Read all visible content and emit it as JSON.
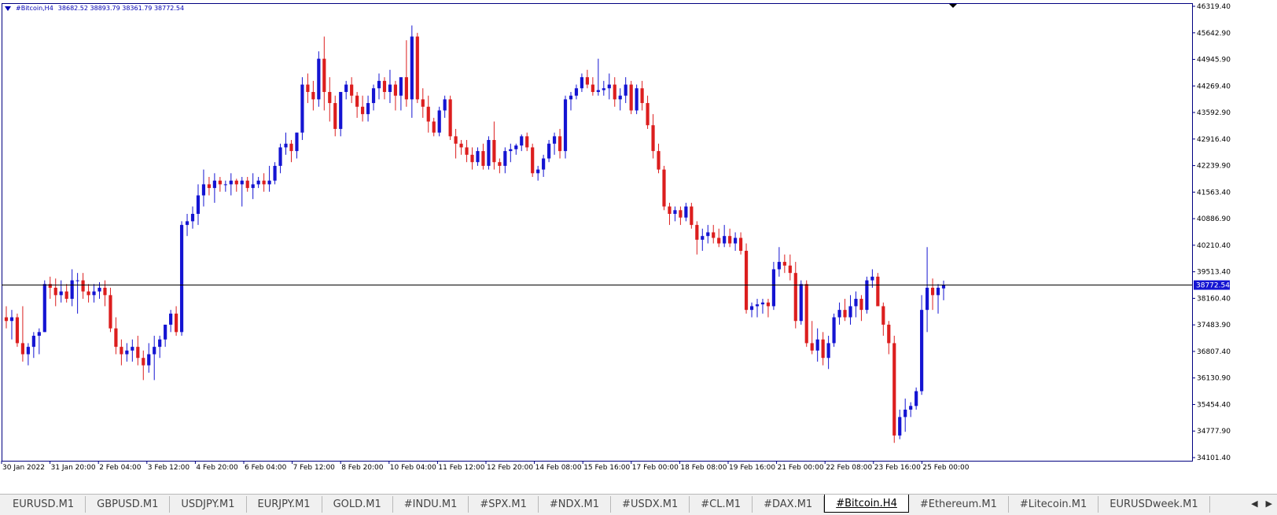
{
  "chart_header": {
    "symbol": "#Bitcoin,H4",
    "ohlc": "38682.52 38893.79 38361.79 38772.54"
  },
  "colors": {
    "bull": "#1414d2",
    "bear": "#dc1e1e",
    "axis": "#000080",
    "price_line": "#000000",
    "price_tag_bg": "#1414d2"
  },
  "chart_data": {
    "type": "candlestick",
    "symbol": "#Bitcoin",
    "timeframe": "H4",
    "ylim": [
      34101.4,
      46319.4
    ],
    "y_ticks": [
      "46319.40",
      "45642.90",
      "44945.90",
      "44269.40",
      "43592.90",
      "42916.40",
      "42239.90",
      "41563.40",
      "40886.90",
      "40210.40",
      "39513.40",
      "38160.40",
      "37483.90",
      "36807.40",
      "36130.90",
      "35454.40",
      "34777.90",
      "34101.40"
    ],
    "x_ticks": [
      "30 Jan 2022",
      "31 Jan 20:00",
      "2 Feb 04:00",
      "3 Feb 12:00",
      "4 Feb 20:00",
      "6 Feb 04:00",
      "7 Feb 12:00",
      "8 Feb 20:00",
      "10 Feb 04:00",
      "11 Feb 12:00",
      "12 Feb 20:00",
      "14 Feb 08:00",
      "15 Feb 16:00",
      "17 Feb 00:00",
      "18 Feb 08:00",
      "19 Feb 16:00",
      "21 Feb 00:00",
      "22 Feb 08:00",
      "23 Feb 16:00",
      "25 Feb 00:00"
    ],
    "current_price": "38772.54",
    "candles": [
      [
        37900,
        38200,
        37600,
        37800
      ],
      [
        37800,
        38100,
        37300,
        37900
      ],
      [
        37900,
        38000,
        37100,
        37200
      ],
      [
        37200,
        38200,
        36700,
        36900
      ],
      [
        36900,
        37200,
        36600,
        37100
      ],
      [
        37100,
        37500,
        36800,
        37400
      ],
      [
        37400,
        37600,
        36900,
        37500
      ],
      [
        37500,
        38900,
        37500,
        38800
      ],
      [
        38800,
        39000,
        38400,
        38700
      ],
      [
        38700,
        38950,
        38200,
        38500
      ],
      [
        38500,
        38900,
        38300,
        38600
      ],
      [
        38600,
        38800,
        38300,
        38400
      ],
      [
        38400,
        39200,
        38200,
        38900
      ],
      [
        38900,
        39100,
        38000,
        38900
      ],
      [
        38900,
        39100,
        38400,
        38600
      ],
      [
        38600,
        38800,
        38300,
        38500
      ],
      [
        38500,
        38800,
        38300,
        38600
      ],
      [
        38600,
        38850,
        38400,
        38700
      ],
      [
        38700,
        38900,
        38200,
        38500
      ],
      [
        38500,
        38700,
        37500,
        37600
      ],
      [
        37600,
        37900,
        36900,
        37100
      ],
      [
        37100,
        37300,
        36600,
        36900
      ],
      [
        36900,
        37200,
        36700,
        37000
      ],
      [
        37000,
        37300,
        36700,
        37100
      ],
      [
        37100,
        37400,
        36600,
        36800
      ],
      [
        36800,
        37000,
        36200,
        36600
      ],
      [
        36600,
        37200,
        36400,
        36900
      ],
      [
        36900,
        37400,
        36200,
        37100
      ],
      [
        37100,
        37400,
        36800,
        37300
      ],
      [
        37300,
        37700,
        37100,
        37700
      ],
      [
        37700,
        38100,
        37500,
        38000
      ],
      [
        38000,
        38200,
        37400,
        37500
      ],
      [
        37500,
        40500,
        37400,
        40400
      ],
      [
        40400,
        40700,
        40100,
        40500
      ],
      [
        40500,
        40900,
        40300,
        40700
      ],
      [
        40700,
        41500,
        40400,
        41200
      ],
      [
        41200,
        41900,
        40900,
        41500
      ],
      [
        41500,
        41700,
        41200,
        41400
      ],
      [
        41400,
        41800,
        41000,
        41600
      ],
      [
        41600,
        41700,
        41300,
        41500
      ],
      [
        41500,
        41600,
        41300,
        41500
      ],
      [
        41500,
        41800,
        41200,
        41600
      ],
      [
        41600,
        41650,
        41300,
        41500
      ],
      [
        41500,
        41700,
        40900,
        41600
      ],
      [
        41600,
        41700,
        41300,
        41400
      ],
      [
        41400,
        41800,
        41100,
        41500
      ],
      [
        41500,
        41700,
        41400,
        41600
      ],
      [
        41600,
        41800,
        41300,
        41500
      ],
      [
        41500,
        42000,
        41300,
        41600
      ],
      [
        41600,
        42100,
        41500,
        42000
      ],
      [
        42000,
        42600,
        41800,
        42500
      ],
      [
        42500,
        42900,
        42300,
        42600
      ],
      [
        42600,
        42700,
        42100,
        42400
      ],
      [
        42400,
        42900,
        42200,
        42900
      ],
      [
        42900,
        44400,
        42700,
        44200
      ],
      [
        44200,
        44500,
        43700,
        44000
      ],
      [
        44000,
        44300,
        43500,
        43800
      ],
      [
        43800,
        45100,
        43600,
        44900
      ],
      [
        44900,
        45500,
        43500,
        44000
      ],
      [
        44000,
        44400,
        43200,
        43700
      ],
      [
        43700,
        43900,
        42800,
        43000
      ],
      [
        43000,
        44000,
        42800,
        44000
      ],
      [
        44000,
        44300,
        43800,
        44200
      ],
      [
        44200,
        44400,
        43700,
        43900
      ],
      [
        43900,
        44000,
        43300,
        43600
      ],
      [
        43600,
        43900,
        43200,
        43400
      ],
      [
        43400,
        43900,
        43200,
        43700
      ],
      [
        43700,
        44200,
        43500,
        44100
      ],
      [
        44100,
        44500,
        43800,
        44300
      ],
      [
        44300,
        44400,
        43800,
        44000
      ],
      [
        44000,
        44600,
        43700,
        44200
      ],
      [
        44200,
        44300,
        43500,
        43900
      ],
      [
        43900,
        44200,
        43500,
        44400
      ],
      [
        44400,
        45400,
        43600,
        43800
      ],
      [
        43800,
        45800,
        43300,
        45500
      ],
      [
        45500,
        45600,
        43700,
        43800
      ],
      [
        43800,
        44100,
        43300,
        43600
      ],
      [
        43600,
        43900,
        42900,
        43200
      ],
      [
        43200,
        43300,
        42800,
        42900
      ],
      [
        42900,
        43600,
        42800,
        43500
      ],
      [
        43500,
        43900,
        43300,
        43800
      ],
      [
        43800,
        43900,
        42700,
        42800
      ],
      [
        42800,
        43000,
        42200,
        42600
      ],
      [
        42600,
        42700,
        42300,
        42500
      ],
      [
        42500,
        42700,
        42100,
        42300
      ],
      [
        42300,
        42500,
        41900,
        42100
      ],
      [
        42100,
        42500,
        42000,
        42400
      ],
      [
        42400,
        42600,
        41900,
        42000
      ],
      [
        42000,
        42800,
        41900,
        42700
      ],
      [
        42700,
        43200,
        41900,
        42100
      ],
      [
        42100,
        42200,
        41800,
        42000
      ],
      [
        42000,
        42500,
        41800,
        42400
      ],
      [
        42400,
        42600,
        42100,
        42450
      ],
      [
        42450,
        42600,
        42300,
        42550
      ],
      [
        42550,
        42850,
        42400,
        42800
      ],
      [
        42800,
        42900,
        42400,
        42500
      ],
      [
        42500,
        42600,
        41700,
        41800
      ],
      [
        41800,
        42000,
        41600,
        41900
      ],
      [
        41900,
        42300,
        41700,
        42200
      ],
      [
        42200,
        42700,
        42100,
        42600
      ],
      [
        42600,
        42900,
        42300,
        42800
      ],
      [
        42800,
        43000,
        42200,
        42400
      ],
      [
        42400,
        43900,
        42200,
        43800
      ],
      [
        43800,
        44000,
        43500,
        43900
      ],
      [
        43900,
        44200,
        43800,
        44100
      ],
      [
        44100,
        44500,
        44000,
        44400
      ],
      [
        44400,
        44600,
        44100,
        44200
      ],
      [
        44200,
        44400,
        43900,
        44000
      ],
      [
        44000,
        44900,
        43900,
        44050
      ],
      [
        44050,
        44300,
        43900,
        44100
      ],
      [
        44100,
        44500,
        43800,
        44200
      ],
      [
        44200,
        44400,
        43600,
        43800
      ],
      [
        43800,
        44100,
        43500,
        43900
      ],
      [
        43900,
        44400,
        43700,
        44200
      ],
      [
        44200,
        44300,
        43400,
        43500
      ],
      [
        43500,
        44200,
        43400,
        44100
      ],
      [
        44100,
        44300,
        43500,
        43700
      ],
      [
        43700,
        43900,
        43000,
        43100
      ],
      [
        43100,
        43400,
        42200,
        42400
      ],
      [
        42400,
        42600,
        41800,
        41900
      ],
      [
        41900,
        42000,
        40800,
        40900
      ],
      [
        40900,
        41000,
        40400,
        40700
      ],
      [
        40700,
        40900,
        40500,
        40800
      ],
      [
        40800,
        40900,
        40400,
        40600
      ],
      [
        40600,
        41000,
        40500,
        40900
      ],
      [
        40900,
        41000,
        40300,
        40400
      ],
      [
        40400,
        40500,
        39600,
        40000
      ],
      [
        40000,
        40300,
        39700,
        40100
      ],
      [
        40100,
        40400,
        39900,
        40200
      ],
      [
        40200,
        40400,
        39900,
        40050
      ],
      [
        40050,
        40300,
        39800,
        39900
      ],
      [
        39900,
        40400,
        39800,
        40100
      ],
      [
        40100,
        40300,
        39800,
        39900
      ],
      [
        39900,
        40200,
        39700,
        40050
      ],
      [
        40050,
        40200,
        39600,
        39700
      ],
      [
        39700,
        39900,
        38000,
        38100
      ],
      [
        38100,
        38300,
        37900,
        38200
      ],
      [
        38200,
        38400,
        37900,
        38250
      ],
      [
        38250,
        38400,
        38000,
        38300
      ],
      [
        38300,
        38400,
        37900,
        38200
      ],
      [
        38200,
        39400,
        38100,
        39200
      ],
      [
        39200,
        39800,
        39000,
        39400
      ],
      [
        39400,
        39600,
        39100,
        39300
      ],
      [
        39300,
        39600,
        38900,
        39100
      ],
      [
        39100,
        39400,
        37600,
        37800
      ],
      [
        37800,
        38900,
        37700,
        38800
      ],
      [
        38800,
        38900,
        37100,
        37200
      ],
      [
        37200,
        37800,
        36900,
        37000
      ],
      [
        37000,
        37600,
        36700,
        37300
      ],
      [
        37300,
        37500,
        36600,
        36800
      ],
      [
        36800,
        37400,
        36500,
        37200
      ],
      [
        37200,
        38000,
        37100,
        37900
      ],
      [
        37900,
        38300,
        37700,
        38100
      ],
      [
        38100,
        38400,
        37800,
        37900
      ],
      [
        37900,
        38500,
        37700,
        38200
      ],
      [
        38200,
        38600,
        37900,
        38400
      ],
      [
        38400,
        38500,
        37800,
        38100
      ],
      [
        38100,
        39000,
        38000,
        38900
      ],
      [
        38900,
        39200,
        38700,
        39000
      ],
      [
        39000,
        39100,
        38400,
        38200
      ],
      [
        38200,
        38300,
        37400,
        37700
      ],
      [
        37700,
        37800,
        36900,
        37200
      ],
      [
        37200,
        37400,
        34500,
        34700
      ],
      [
        34700,
        35400,
        34600,
        35200
      ],
      [
        35200,
        35700,
        34800,
        35400
      ],
      [
        35400,
        35600,
        35200,
        35500
      ],
      [
        35500,
        36000,
        35400,
        35900
      ],
      [
        35900,
        38500,
        35800,
        38100
      ],
      [
        38100,
        39800,
        37500,
        38700
      ],
      [
        38700,
        38950,
        38100,
        38500
      ],
      [
        38500,
        38800,
        38000,
        38700
      ],
      [
        38682.52,
        38893.79,
        38361.79,
        38772.54
      ]
    ]
  },
  "tabs": [
    {
      "label": "EURUSD.M1",
      "active": false
    },
    {
      "label": "GBPUSD.M1",
      "active": false
    },
    {
      "label": "USDJPY.M1",
      "active": false
    },
    {
      "label": "EURJPY.M1",
      "active": false
    },
    {
      "label": "GOLD.M1",
      "active": false
    },
    {
      "label": "#INDU.M1",
      "active": false
    },
    {
      "label": "#SPX.M1",
      "active": false
    },
    {
      "label": "#NDX.M1",
      "active": false
    },
    {
      "label": "#USDX.M1",
      "active": false
    },
    {
      "label": "#CL.M1",
      "active": false
    },
    {
      "label": "#DAX.M1",
      "active": false
    },
    {
      "label": "#Bitcoin.H4",
      "active": true
    },
    {
      "label": "#Ethereum.M1",
      "active": false
    },
    {
      "label": "#Litecoin.M1",
      "active": false
    },
    {
      "label": "EURUSDweek.M1",
      "active": false
    }
  ],
  "tab_nav": {
    "prev": "◀",
    "next": "▶"
  }
}
